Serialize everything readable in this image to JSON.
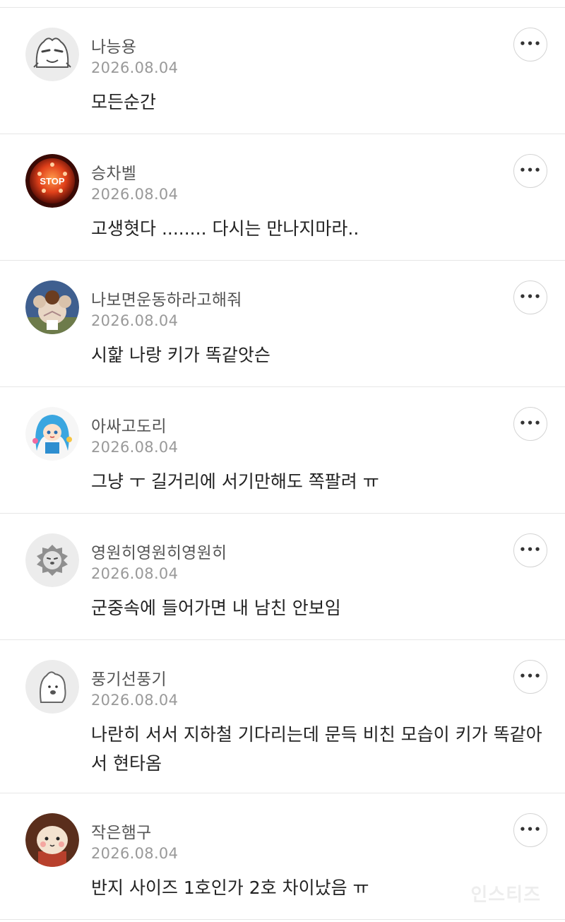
{
  "comments": [
    {
      "author": "나능용",
      "date": "2026.08.04",
      "text": "모든순간",
      "avatar_icon": "gray-cat-character-icon"
    },
    {
      "author": "승차벨",
      "date": "2026.08.04",
      "text": "고생혓다 ........ 다시는 만나지마라..",
      "avatar_icon": "stop-button-icon",
      "avatar_label": "STOP"
    },
    {
      "author": "나보면운동하라고해줘",
      "date": "2026.08.04",
      "text": "시핥 나랑 키가 똑같앗슨",
      "avatar_icon": "muscle-character-icon"
    },
    {
      "author": "아싸고도리",
      "date": "2026.08.04",
      "text": "그냥 ㅜ 길거리에 서기만해도 쪽팔려 ㅠ",
      "avatar_icon": "blue-hair-girl-icon"
    },
    {
      "author": "영원히영원히영원히",
      "date": "2026.08.04",
      "text": "군중속에 들어가면 내 남친 안보임",
      "avatar_icon": "lion-face-icon"
    },
    {
      "author": "풍기선풍기",
      "date": "2026.08.04",
      "text": "나란히 서서 지하철 기다리는데 문득 비친 모습이 키가 똑같아서 현타옴",
      "avatar_icon": "blob-character-icon"
    },
    {
      "author": "작은햄구",
      "date": "2026.08.04",
      "text": "반지 사이즈 1호인가 2호 차이났음 ㅠ",
      "avatar_icon": "hamster-character-icon"
    }
  ],
  "more_label": "•••",
  "watermark": "인스티즈"
}
